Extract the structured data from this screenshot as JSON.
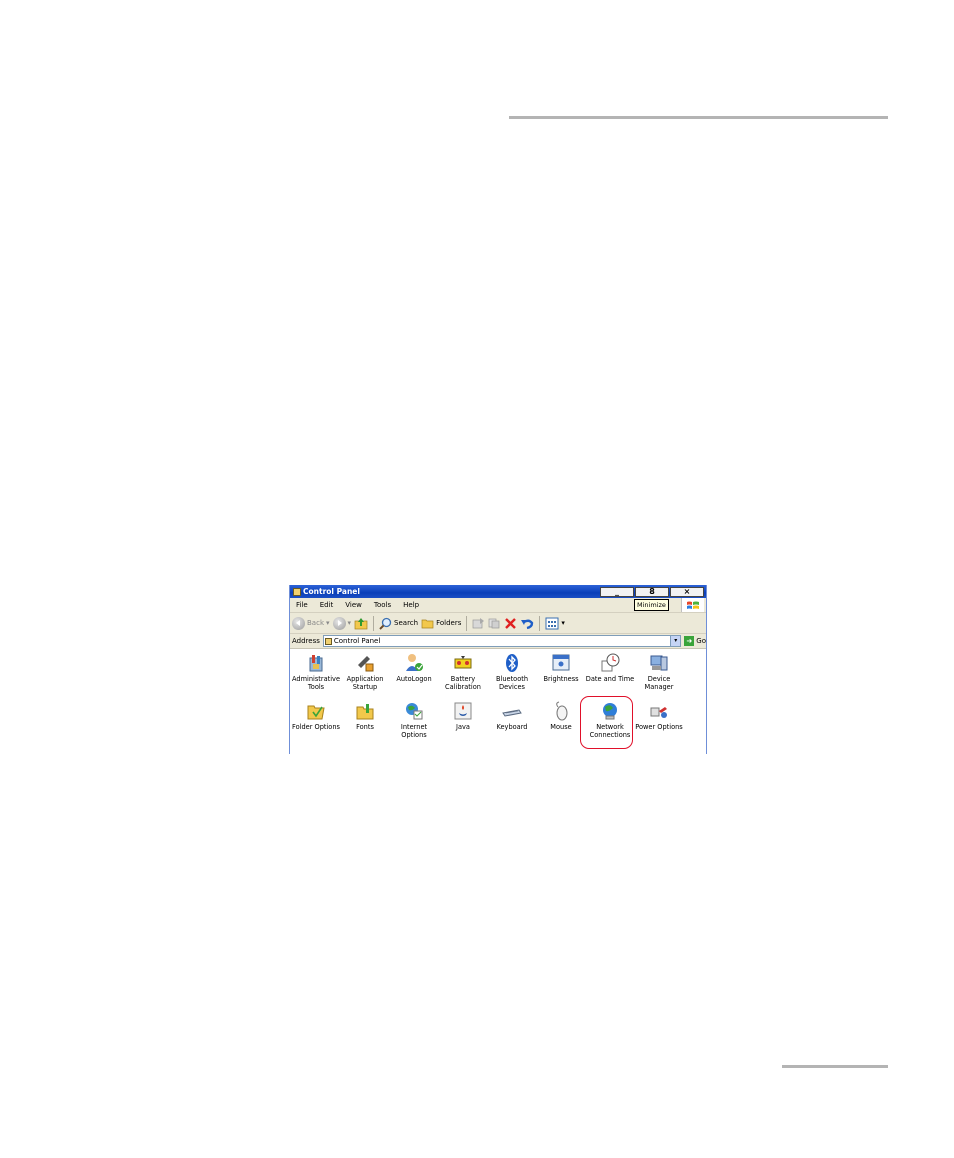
{
  "window": {
    "title": "Control Panel"
  },
  "title_buttons": {
    "minimize": "_",
    "restore": "8",
    "close": "×"
  },
  "menu": [
    "File",
    "Edit",
    "View",
    "Tools",
    "Help"
  ],
  "tooltip": "Minimize",
  "toolbar": {
    "back": "Back",
    "search": "Search",
    "folders": "Folders"
  },
  "address": {
    "label": "Address",
    "value": "Control Panel",
    "go": "Go"
  },
  "items": [
    {
      "label": "Administrative Tools",
      "icon": "administrative-tools-icon"
    },
    {
      "label": "Application Startup",
      "icon": "application-startup-icon"
    },
    {
      "label": "AutoLogon",
      "icon": "autologon-icon"
    },
    {
      "label": "Battery Calibration",
      "icon": "battery-calibration-icon"
    },
    {
      "label": "Bluetooth Devices",
      "icon": "bluetooth-icon"
    },
    {
      "label": "Brightness",
      "icon": "brightness-icon"
    },
    {
      "label": "Date and Time",
      "icon": "date-time-icon"
    },
    {
      "label": "Device Manager",
      "icon": "device-manager-icon"
    },
    {
      "label": "Folder Options",
      "icon": "folder-options-icon"
    },
    {
      "label": "Fonts",
      "icon": "fonts-icon"
    },
    {
      "label": "Internet Options",
      "icon": "internet-options-icon"
    },
    {
      "label": "Java",
      "icon": "java-icon"
    },
    {
      "label": "Keyboard",
      "icon": "keyboard-icon"
    },
    {
      "label": "Mouse",
      "icon": "mouse-icon"
    },
    {
      "label": "Network Connections",
      "icon": "network-connections-icon"
    },
    {
      "label": "Power Options",
      "icon": "power-options-icon"
    }
  ],
  "highlight_color": "#e0102a"
}
